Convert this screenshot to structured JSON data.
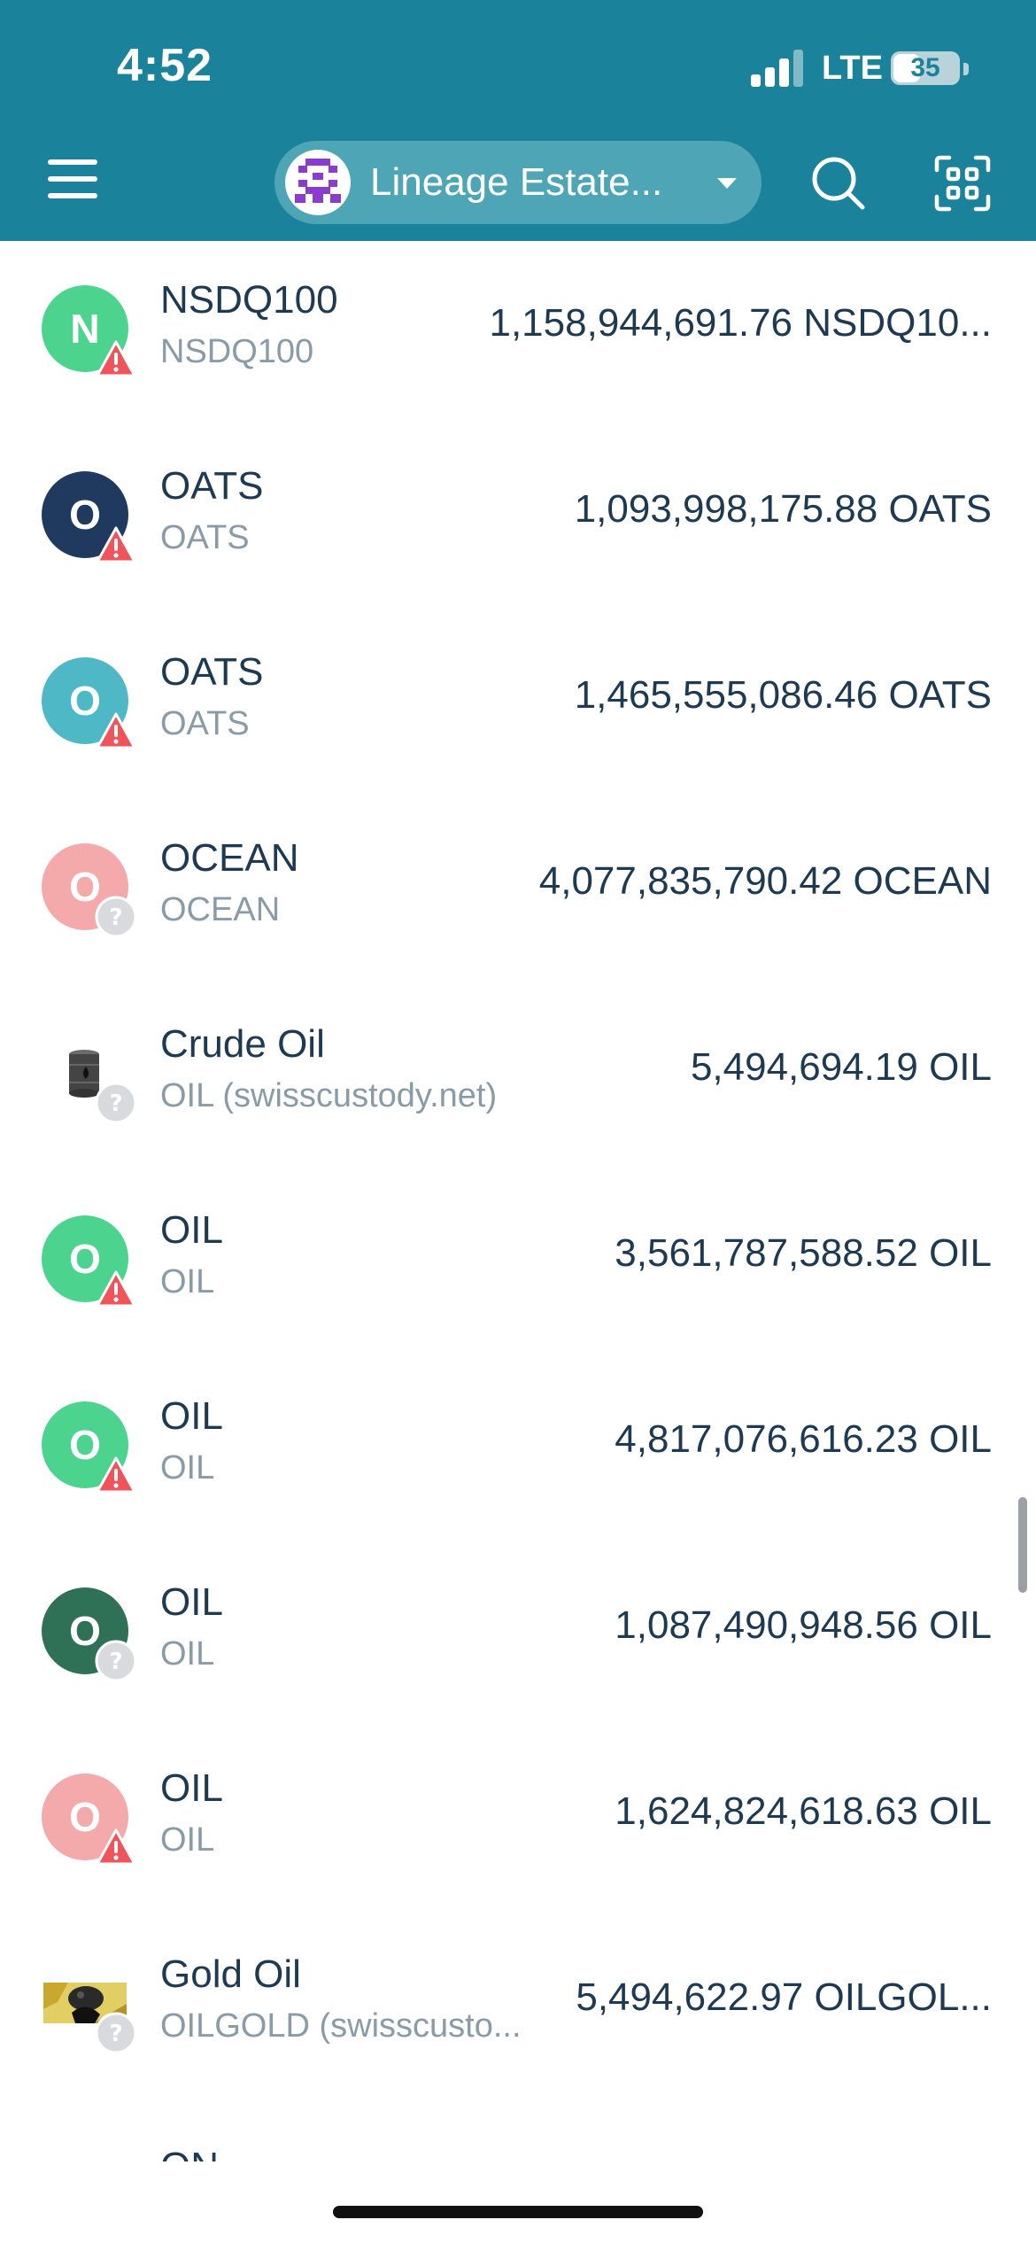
{
  "status_bar": {
    "time": "4:52",
    "network": "LTE",
    "battery": "35"
  },
  "header": {
    "account_name": "Lineage Estate..."
  },
  "tokens": [
    {
      "name": "NSDQ100",
      "subtitle": "NSDQ100",
      "balance": "1,158,944,691.76 NSDQ10...",
      "letter": "N",
      "color": "#4cd48f",
      "badge": "warning"
    },
    {
      "name": "OATS",
      "subtitle": "OATS",
      "balance": "1,093,998,175.88 OATS",
      "letter": "O",
      "color": "#1f3a5e",
      "badge": "warning"
    },
    {
      "name": "OATS",
      "subtitle": "OATS",
      "balance": "1,465,555,086.46 OATS",
      "letter": "O",
      "color": "#4eb8c6",
      "badge": "warning"
    },
    {
      "name": "OCEAN",
      "subtitle": "OCEAN",
      "balance": "4,077,835,790.42 OCEAN",
      "letter": "O",
      "color": "#f4a9ab",
      "badge": "unknown"
    },
    {
      "name": "Crude Oil",
      "subtitle": "OIL (swisscustody.net)",
      "balance": "5,494,694.19 OIL",
      "icon": "oil-barrel",
      "badge": "unknown"
    },
    {
      "name": "OIL",
      "subtitle": "OIL",
      "balance": "3,561,787,588.52 OIL",
      "letter": "O",
      "color": "#4cd48f",
      "badge": "warning"
    },
    {
      "name": "OIL",
      "subtitle": "OIL",
      "balance": "4,817,076,616.23 OIL",
      "letter": "O",
      "color": "#4cd48f",
      "badge": "warning"
    },
    {
      "name": "OIL",
      "subtitle": "OIL",
      "balance": "1,087,490,948.56 OIL",
      "letter": "O",
      "color": "#2e7157",
      "badge": "unknown"
    },
    {
      "name": "OIL",
      "subtitle": "OIL",
      "balance": "1,624,824,618.63 OIL",
      "letter": "O",
      "color": "#f4a9ab",
      "badge": "warning"
    },
    {
      "name": "Gold Oil",
      "subtitle": "OILGOLD (swisscusto...",
      "balance": "5,494,622.97 OILGOL...",
      "icon": "gold-oil",
      "badge": "unknown"
    }
  ],
  "next_item_peek": "ON"
}
